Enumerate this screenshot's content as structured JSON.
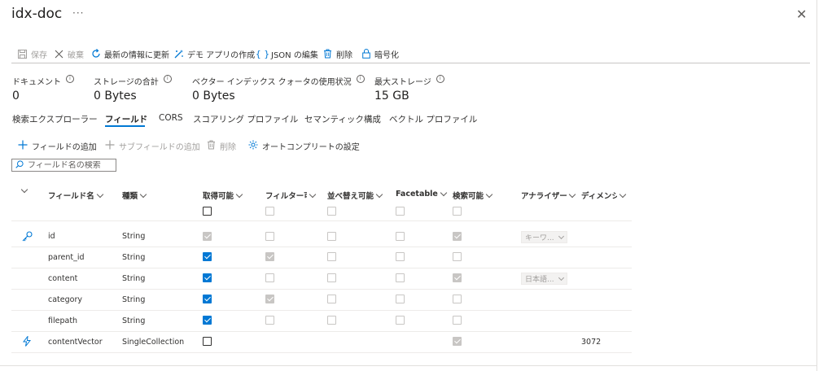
{
  "window": {
    "title": "idx-doc",
    "more": "···",
    "close": "✕"
  },
  "toolbar": {
    "save": "保存",
    "discard": "破棄",
    "refresh": "最新の情報に更新",
    "demo_app": "デモ アプリの作成",
    "json_edit": "JSON の編集",
    "delete": "削除",
    "encrypt": "暗号化"
  },
  "stats": [
    {
      "label": "ドキュメント",
      "value": "0"
    },
    {
      "label": "ストレージの合計",
      "value": "0 Bytes"
    },
    {
      "label": "ベクター インデックス クォータの使用状況",
      "value": "0 Bytes"
    },
    {
      "label": "最大ストレージ",
      "value": "15 GB"
    }
  ],
  "tabs": [
    "検索エクスプローラー",
    "フィールド",
    "CORS",
    "スコアリング プロファイル",
    "セマンティック構成",
    "ベクトル プロファイル"
  ],
  "active_tab": "フィールド",
  "actions": {
    "add_field": "フィールドの追加",
    "add_subfield": "サブフィールドの追加",
    "delete": "削除",
    "autocomplete": "オートコンプリートの設定"
  },
  "search": {
    "placeholder": "フィールド名の検索"
  },
  "columns": {
    "name": "フィールド名",
    "type": "種類",
    "retrievable": "取得可能",
    "filterable": "フィルター可",
    "sortable": "並べ替え可能",
    "facetable": "Facetable",
    "searchable": "検索可能",
    "analyzer": "アナライザー",
    "dimensions": "ディメンション"
  },
  "rows": [
    {
      "name": "id",
      "type": "String",
      "analyzer": "キーワ...",
      "dimensions": ""
    },
    {
      "name": "parent_id",
      "type": "String",
      "analyzer": "",
      "dimensions": ""
    },
    {
      "name": "content",
      "type": "String",
      "analyzer": "日本語...",
      "dimensions": ""
    },
    {
      "name": "category",
      "type": "String",
      "analyzer": "",
      "dimensions": ""
    },
    {
      "name": "filepath",
      "type": "String",
      "analyzer": "",
      "dimensions": ""
    },
    {
      "name": "contentVector",
      "type": "SingleCollection",
      "analyzer": "",
      "dimensions": "3072"
    }
  ],
  "colors": {
    "accent": "#0078d4",
    "border": "#c8c6c4"
  }
}
